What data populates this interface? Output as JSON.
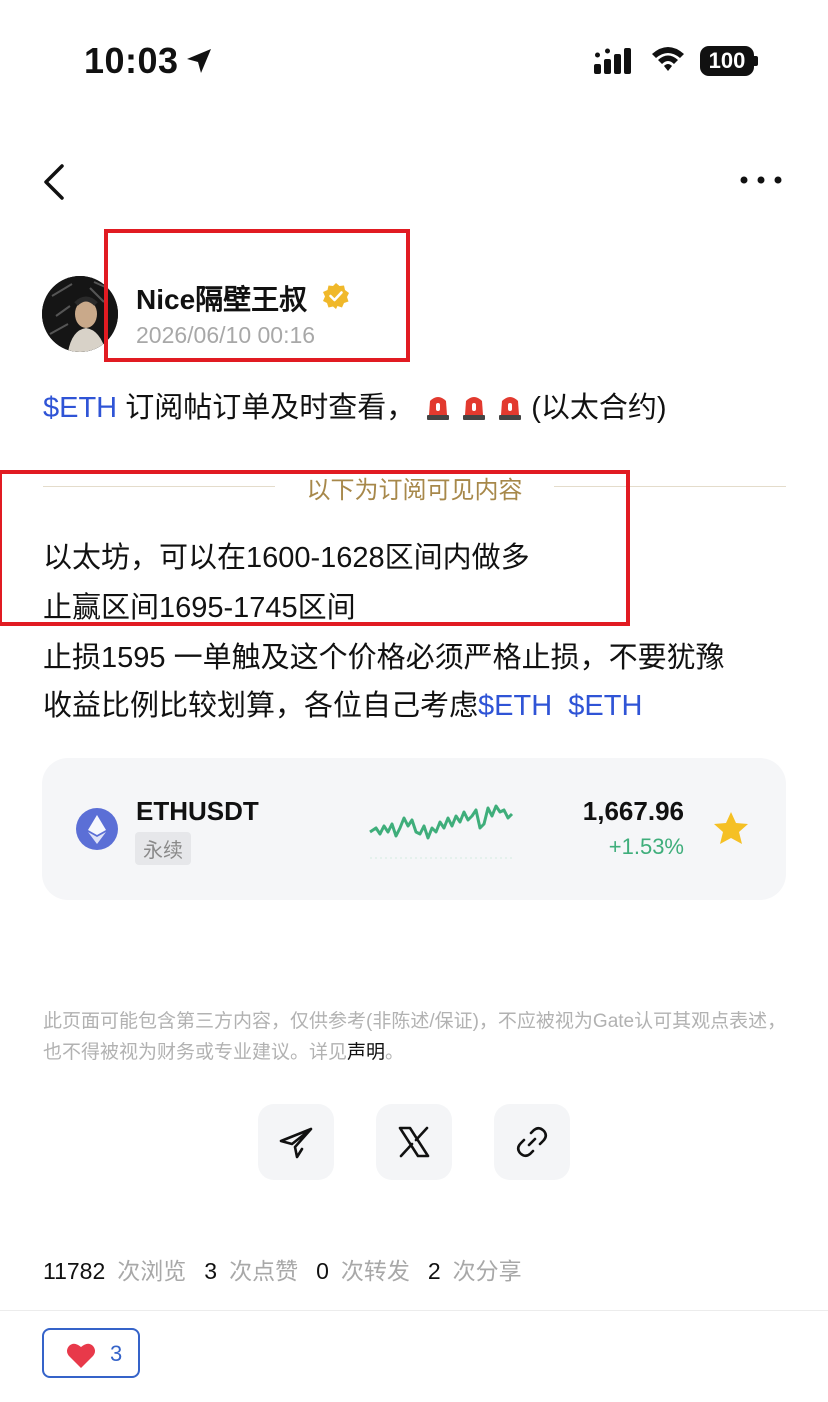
{
  "status_bar": {
    "time": "10:03",
    "battery": "100"
  },
  "author": {
    "name": "Nice隔壁王叔",
    "time": "2026/06/10 00:16"
  },
  "post": {
    "title_tag": "$ETH",
    "title_text": " 订阅帖订单及时查看，",
    "title_suffix": "(以太合约)",
    "divider_label": "以下为订阅可见内容",
    "line1": "以太坊，可以在1600-1628区间内做多",
    "line2": "止赢区间1695-1745区间",
    "line3": "止损1595 一单触及这个价格必须严格止损，不要犹豫",
    "line4_text": "收益比例比较划算，各位自己考虑",
    "line4_tag1": "$ETH",
    "line4_tag2": "$ETH"
  },
  "ticker": {
    "symbol": "ETHUSDT",
    "badge": "永续",
    "price": "1,667.96",
    "change": "+1.53%",
    "icon": "ethereum-icon",
    "colors": {
      "up": "#3fae7b",
      "star": "#f5c024",
      "eth": "#5b6fd6"
    }
  },
  "disclaimer": {
    "text": "此页面可能包含第三方内容，仅供参考(非陈述/保证)，不应被视为Gate认可其观点表述，也不得被视为财务或专业建议。详见",
    "link": "声明",
    "end": "。"
  },
  "share": [
    "telegram-icon",
    "x-icon",
    "link-icon"
  ],
  "stats": {
    "views": "11782",
    "views_label": "次浏览",
    "likes": "3",
    "likes_label": "次点赞",
    "reposts": "0",
    "reposts_label": "次转发",
    "shares": "2",
    "shares_label": "次分享"
  },
  "like_button": {
    "count": "3"
  }
}
